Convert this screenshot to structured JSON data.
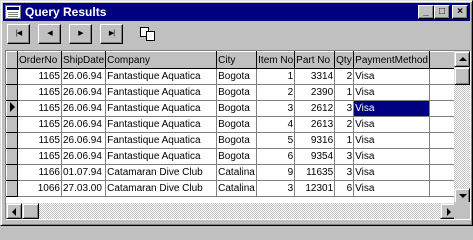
{
  "window": {
    "title": "Query Results"
  },
  "caption_buttons": {
    "minimize": "_",
    "maximize": "□",
    "close": "×"
  },
  "toolbar": {
    "first": "|◀",
    "prev": "◀",
    "next": "▶",
    "last": "▶|",
    "copy_icon": "copy-icon"
  },
  "grid": {
    "columns": [
      "OrderNo",
      "ShipDate",
      "Company",
      "City",
      "Item No",
      "Part No",
      "Qty",
      "PaymentMethod"
    ],
    "rows": [
      [
        "1165",
        "26.06.94",
        "Fantastique Aquatica",
        "Bogota",
        "1",
        "3314",
        "2",
        "Visa"
      ],
      [
        "1165",
        "26.06.94",
        "Fantastique Aquatica",
        "Bogota",
        "2",
        "2390",
        "1",
        "Visa"
      ],
      [
        "1165",
        "26.06.94",
        "Fantastique Aquatica",
        "Bogota",
        "3",
        "2612",
        "3",
        "Visa"
      ],
      [
        "1165",
        "26.06.94",
        "Fantastique Aquatica",
        "Bogota",
        "4",
        "2613",
        "2",
        "Visa"
      ],
      [
        "1165",
        "26.06.94",
        "Fantastique Aquatica",
        "Bogota",
        "5",
        "9316",
        "1",
        "Visa"
      ],
      [
        "1165",
        "26.06.94",
        "Fantastique Aquatica",
        "Bogota",
        "6",
        "9354",
        "3",
        "Visa"
      ],
      [
        "1166",
        "01.07.94",
        "Catamaran Dive Club",
        "Catalina",
        "9",
        "11635",
        "3",
        "Visa"
      ],
      [
        "1066",
        "27.03.00",
        "Catamaran Dive Club",
        "Catalina",
        "3",
        "12301",
        "6",
        "Visa"
      ]
    ],
    "current_row": 2
  },
  "colors": {
    "titlebar": "#000080",
    "selection": "#000080",
    "face": "#c0c0c0"
  }
}
